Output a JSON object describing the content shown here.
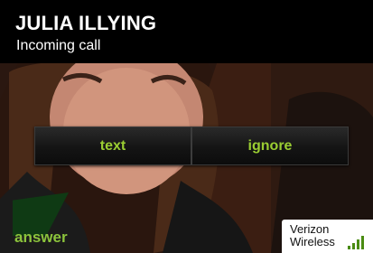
{
  "caller": {
    "name": "JULIA ILLYING",
    "status": "Incoming call"
  },
  "actions": {
    "text_label": "text",
    "ignore_label": "ignore",
    "answer_label": "answer"
  },
  "carrier": {
    "line1": "Verizon",
    "line2": "Wireless",
    "signal_icon": "signal-bars-icon"
  },
  "colors": {
    "accent": "#9acd32",
    "answer_tab": "#0f3a14",
    "background": "#000000"
  }
}
